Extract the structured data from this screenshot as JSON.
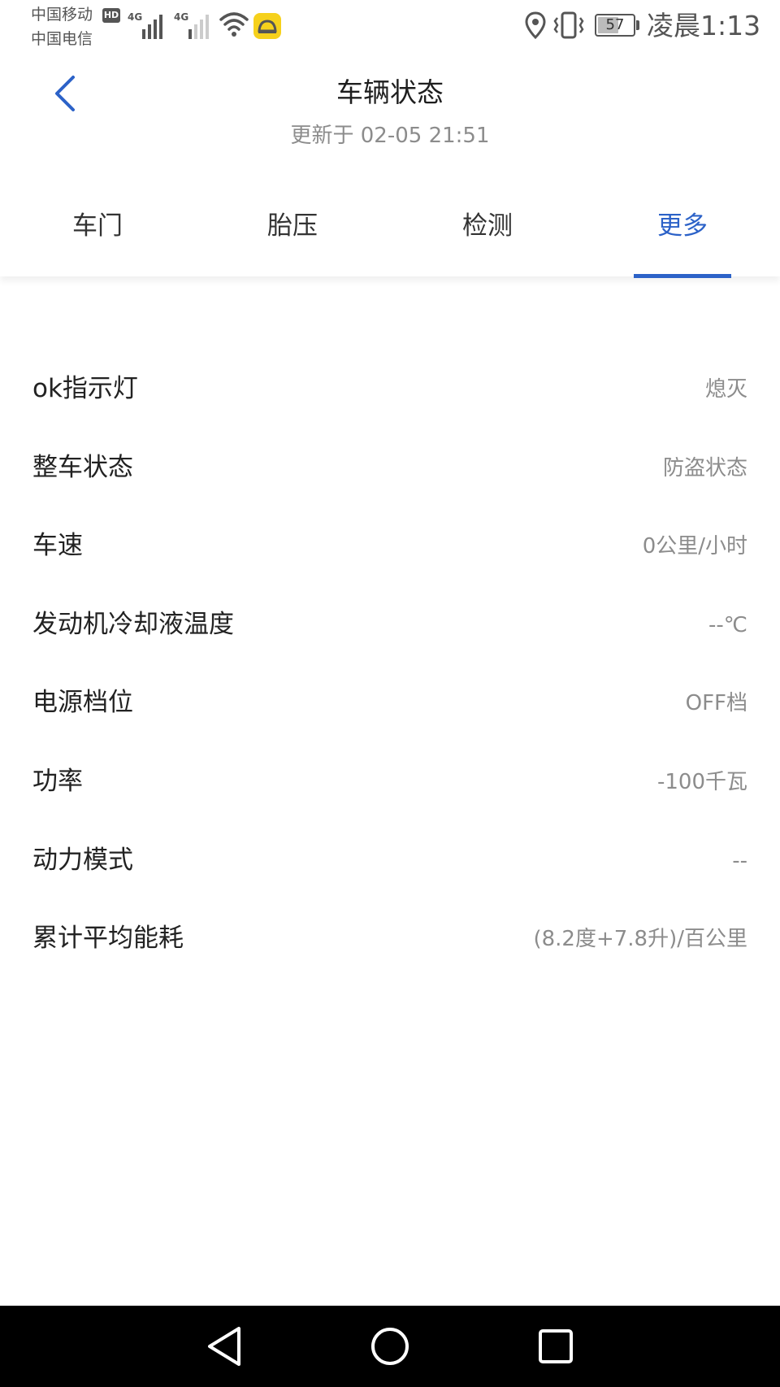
{
  "status_bar": {
    "carrier_1": "中国移动",
    "carrier_2": "中国电信",
    "hd_badge": "HD",
    "signal_1_label": "4G",
    "signal_2_label": "4G",
    "battery_level": "57",
    "time": "凌晨1:13",
    "icons": [
      "hd-icon",
      "signal-icon",
      "signal-icon",
      "wifi-icon",
      "car-app-icon",
      "location-icon",
      "vibrate-icon",
      "battery-icon"
    ]
  },
  "header": {
    "back_icon": "chevron-left-icon",
    "title": "车辆状态",
    "subtitle": "更新于 02-05 21:51"
  },
  "tabs": [
    {
      "label": "车门",
      "active": false
    },
    {
      "label": "胎压",
      "active": false
    },
    {
      "label": "检测",
      "active": false
    },
    {
      "label": "更多",
      "active": true
    }
  ],
  "status_list": [
    {
      "label": "ok指示灯",
      "value": "熄灭"
    },
    {
      "label": "整车状态",
      "value": "防盗状态"
    },
    {
      "label": "车速",
      "value": "0公里/小时"
    },
    {
      "label": "发动机冷却液温度",
      "value": "--℃"
    },
    {
      "label": "电源档位",
      "value": "OFF档"
    },
    {
      "label": "功率",
      "value": "-100千瓦"
    },
    {
      "label": "动力模式",
      "value": "--"
    },
    {
      "label": "累计平均能耗",
      "value": "(8.2度+7.8升)/百公里"
    }
  ],
  "nav_bar": {
    "icons": [
      "nav-back-icon",
      "nav-home-icon",
      "nav-recent-icon"
    ]
  },
  "colors": {
    "accent": "#2c62c8",
    "text_primary": "#222222",
    "text_secondary": "#8c8c8c",
    "nav_background": "#000000"
  }
}
